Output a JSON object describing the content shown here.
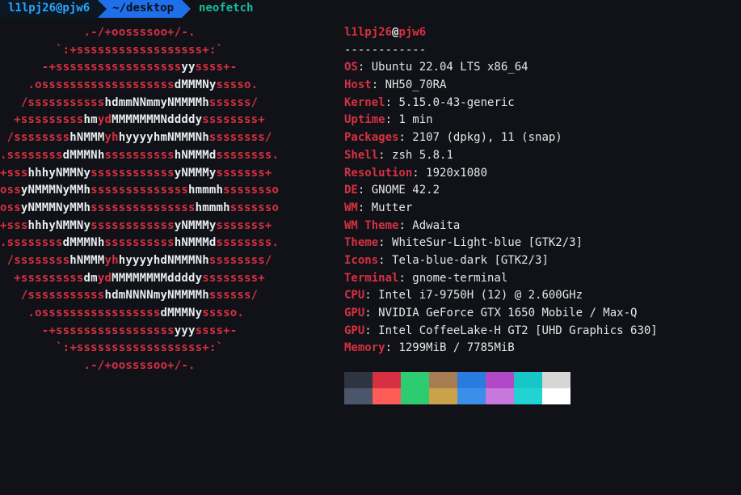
{
  "prompt": {
    "user": "l1lpj26@pjw6",
    "path": "~/desktop",
    "command": "neofetch"
  },
  "logo": [
    [
      {
        "r": "            .-/+oossssoo+/-."
      }
    ],
    [
      {
        "r": "        `:+ssssssssssssssssss+:`"
      }
    ],
    [
      {
        "r": "      -+ssssssssssssssssss"
      },
      {
        "w": "yy"
      },
      {
        "r": "ssss+-"
      }
    ],
    [
      {
        "r": "    .osssssssssssssssssss"
      },
      {
        "w": "dMMMNy"
      },
      {
        "r": "sssso."
      }
    ],
    [
      {
        "r": "   /sssssssssss"
      },
      {
        "w": "hdmmNNmmyNMMMMh"
      },
      {
        "r": "ssssss/"
      }
    ],
    [
      {
        "r": "  +sssssssss"
      },
      {
        "w": "hm"
      },
      {
        "r": "yd"
      },
      {
        "w": "MMMMMMMNddddy"
      },
      {
        "r": "ssssssss+"
      }
    ],
    [
      {
        "r": " /ssssssss"
      },
      {
        "w": "hNMMM"
      },
      {
        "r": "yh"
      },
      {
        "w": "hyyyyhmNMMMNh"
      },
      {
        "r": "ssssssss/"
      }
    ],
    [
      {
        "r": ".ssssssss"
      },
      {
        "w": "dMMMNh"
      },
      {
        "r": "ssssssssss"
      },
      {
        "w": "hNMMMd"
      },
      {
        "r": "ssssssss."
      }
    ],
    [
      {
        "r": "+sss"
      },
      {
        "w": "hhhyNMMNy"
      },
      {
        "r": "ssssssssssss"
      },
      {
        "w": "yNMMMy"
      },
      {
        "r": "sssssss+"
      }
    ],
    [
      {
        "r": "oss"
      },
      {
        "w": "yNMMMNyMMh"
      },
      {
        "r": "ssssssssssssss"
      },
      {
        "w": "hmmmh"
      },
      {
        "r": "ssssssso"
      }
    ],
    [
      {
        "r": "oss"
      },
      {
        "w": "yNMMMNyMMh"
      },
      {
        "r": "sssssssssssssss"
      },
      {
        "w": "hmmmh"
      },
      {
        "r": "sssssso"
      }
    ],
    [
      {
        "r": "+sss"
      },
      {
        "w": "hhhyNMMNy"
      },
      {
        "r": "ssssssssssss"
      },
      {
        "w": "yNMMMy"
      },
      {
        "r": "sssssss+"
      }
    ],
    [
      {
        "r": ".ssssssss"
      },
      {
        "w": "dMMMNh"
      },
      {
        "r": "ssssssssss"
      },
      {
        "w": "hNMMMd"
      },
      {
        "r": "ssssssss."
      }
    ],
    [
      {
        "r": " /ssssssss"
      },
      {
        "w": "hNMMM"
      },
      {
        "r": "yh"
      },
      {
        "w": "hyyyyhdNMMMNh"
      },
      {
        "r": "ssssssss/"
      }
    ],
    [
      {
        "r": "  +sssssssss"
      },
      {
        "w": "dm"
      },
      {
        "r": "yd"
      },
      {
        "w": "MMMMMMMMddddy"
      },
      {
        "r": "ssssssss+"
      }
    ],
    [
      {
        "r": "   /sssssssssss"
      },
      {
        "w": "hdmNNNNmyNMMMMh"
      },
      {
        "r": "ssssss/"
      }
    ],
    [
      {
        "r": "    .osssssssssssssssss"
      },
      {
        "w": "dMMMNy"
      },
      {
        "r": "sssso."
      }
    ],
    [
      {
        "r": "      -+sssssssssssssssss"
      },
      {
        "w": "yyy"
      },
      {
        "r": "ssss+-"
      }
    ],
    [
      {
        "r": "        `:+ssssssssssssssssss+:`"
      }
    ],
    [
      {
        "r": "            .-/+oossssoo+/-."
      }
    ]
  ],
  "header": {
    "user": "l1lpj26",
    "at": "@",
    "host": "pjw6"
  },
  "dashline": "------------",
  "fields": [
    {
      "key": "OS",
      "value": "Ubuntu 22.04 LTS x86_64"
    },
    {
      "key": "Host",
      "value": "NH50_70RA"
    },
    {
      "key": "Kernel",
      "value": "5.15.0-43-generic"
    },
    {
      "key": "Uptime",
      "value": "1 min"
    },
    {
      "key": "Packages",
      "value": "2107 (dpkg), 11 (snap)"
    },
    {
      "key": "Shell",
      "value": "zsh 5.8.1"
    },
    {
      "key": "Resolution",
      "value": "1920x1080"
    },
    {
      "key": "DE",
      "value": "GNOME 42.2"
    },
    {
      "key": "WM",
      "value": "Mutter"
    },
    {
      "key": "WM Theme",
      "value": "Adwaita"
    },
    {
      "key": "Theme",
      "value": "WhiteSur-Light-blue [GTK2/3]"
    },
    {
      "key": "Icons",
      "value": "Tela-blue-dark [GTK2/3]"
    },
    {
      "key": "Terminal",
      "value": "gnome-terminal"
    },
    {
      "key": "CPU",
      "value": "Intel i7-9750H (12) @ 2.600GHz"
    },
    {
      "key": "GPU",
      "value": "NVIDIA GeForce GTX 1650 Mobile / Max-Q"
    },
    {
      "key": "GPU",
      "value": "Intel CoffeeLake-H GT2 [UHD Graphics 630]"
    },
    {
      "key": "Memory",
      "value": "1299MiB / 7785MiB"
    }
  ],
  "colors": [
    "#2e3440",
    "#d73043",
    "#2ecc71",
    "#a67c52",
    "#2a7bde",
    "#b048c8",
    "#17c6c6",
    "#d6d6d6",
    "#4c566a",
    "#ff5c57",
    "#2ecc71",
    "#c9a24a",
    "#3b8eea",
    "#c678dd",
    "#22d3d3",
    "#ffffff"
  ]
}
